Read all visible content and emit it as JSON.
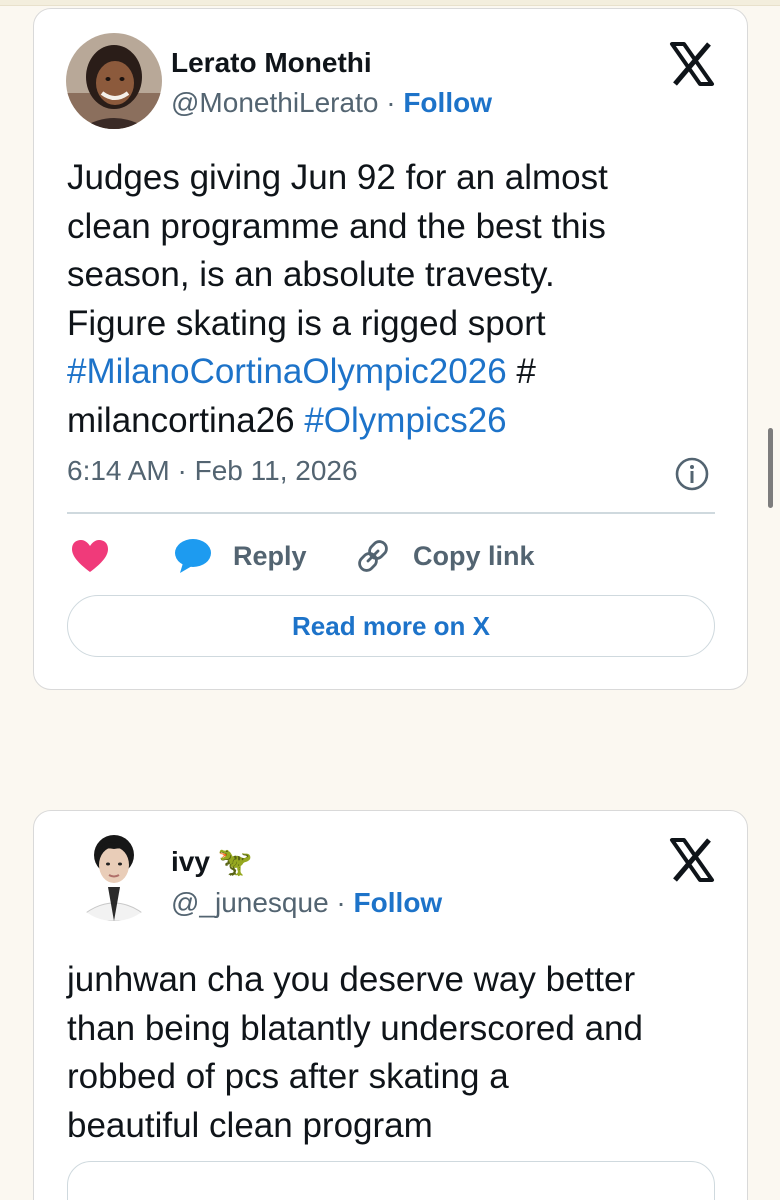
{
  "tweets": [
    {
      "author_name": "Lerato Monethi",
      "handle": "@MonethiLerato",
      "separator": " · ",
      "follow_label": "Follow",
      "text_lines": [
        "Judges giving Jun 92 for an almost",
        "clean programme and the best this",
        "season, is an absolute travesty.",
        "Figure skating is a rigged sport"
      ],
      "hashtag_1": "#MilanoCortinaOlympic2026",
      "hash_trail": " #",
      "text_line_6_plain": "milancortina26 ",
      "hashtag_2": "#Olympics26",
      "timestamp": "6:14 AM · Feb 11, 2026",
      "actions": {
        "reply_label": "Reply",
        "copy_label": "Copy link"
      },
      "read_more_label": "Read more on X",
      "x_icon": "x-logo-icon",
      "info_icon": "info-icon",
      "like_icon": "heart-icon",
      "reply_icon": "speech-bubble-icon",
      "copy_icon": "link-icon"
    },
    {
      "author_name": "ivy",
      "name_emoji": "🦖",
      "handle": "@_junesque",
      "separator": " · ",
      "follow_label": "Follow",
      "text_lines": [
        "junhwan cha you deserve way better",
        "than being blatantly underscored and",
        "robbed of pcs after skating a",
        "beautiful clean program"
      ],
      "x_icon": "x-logo-icon"
    }
  ],
  "colors": {
    "page_background": "#fbf8f1",
    "link_blue": "#1d73c9",
    "heart_pink": "#f03a7a",
    "reply_blue": "#1d9bf0",
    "secondary_text": "#536471",
    "border": "#d9d9d9"
  }
}
